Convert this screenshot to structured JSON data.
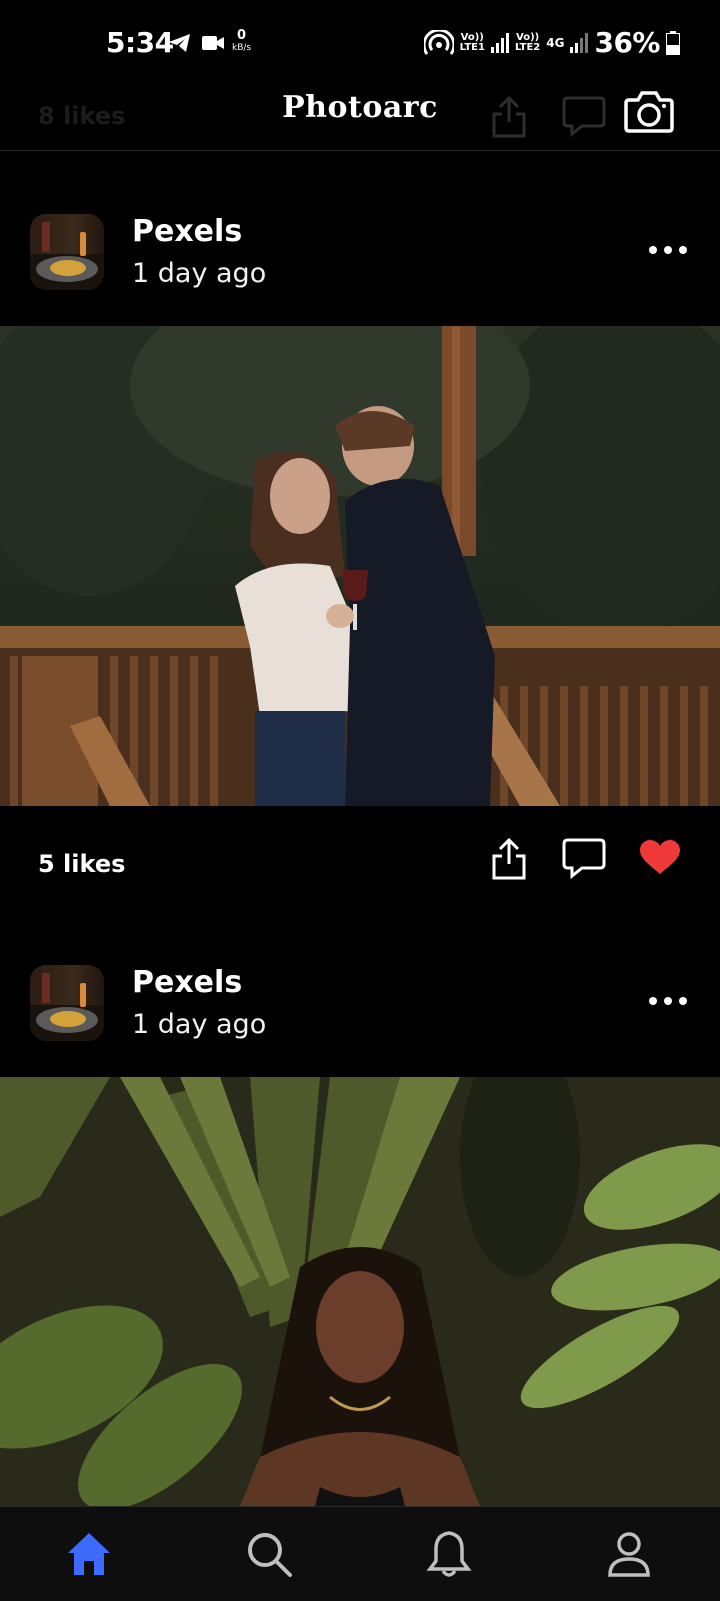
{
  "status_bar": {
    "time": "5:34",
    "net_speed_value": "0",
    "net_speed_unit": "kB/s",
    "sim1_top": "Vo))",
    "sim1_bottom": "LTE1",
    "sim2_top": "Vo))",
    "sim2_bottom": "LTE2",
    "net_type": "4G",
    "battery": "36%",
    "icons": [
      "telegram-icon",
      "video-camera-icon",
      "hotspot-icon",
      "signal-icon",
      "battery-icon"
    ]
  },
  "header": {
    "title": "Photoarc",
    "behind_likes": "8 likes",
    "camera_icon": "camera-icon"
  },
  "posts": [
    {
      "user": "Pexels",
      "time": "1 day ago",
      "likes": "5 likes",
      "liked": true,
      "image": "couple-on-wooden-deck-photo"
    },
    {
      "user": "Pexels",
      "time": "1 day ago",
      "image": "woman-among-palm-leaves-photo"
    }
  ],
  "bottom_nav": [
    {
      "name": "home",
      "icon": "home-icon",
      "active": true
    },
    {
      "name": "search",
      "icon": "search-icon",
      "active": false
    },
    {
      "name": "notifications",
      "icon": "bell-icon",
      "active": false
    },
    {
      "name": "profile",
      "icon": "user-icon",
      "active": false
    }
  ],
  "colors": {
    "background": "#000000",
    "accent": "#3d6bff",
    "like": "#f03a3a",
    "nav_inactive": "#bfbfbf"
  }
}
